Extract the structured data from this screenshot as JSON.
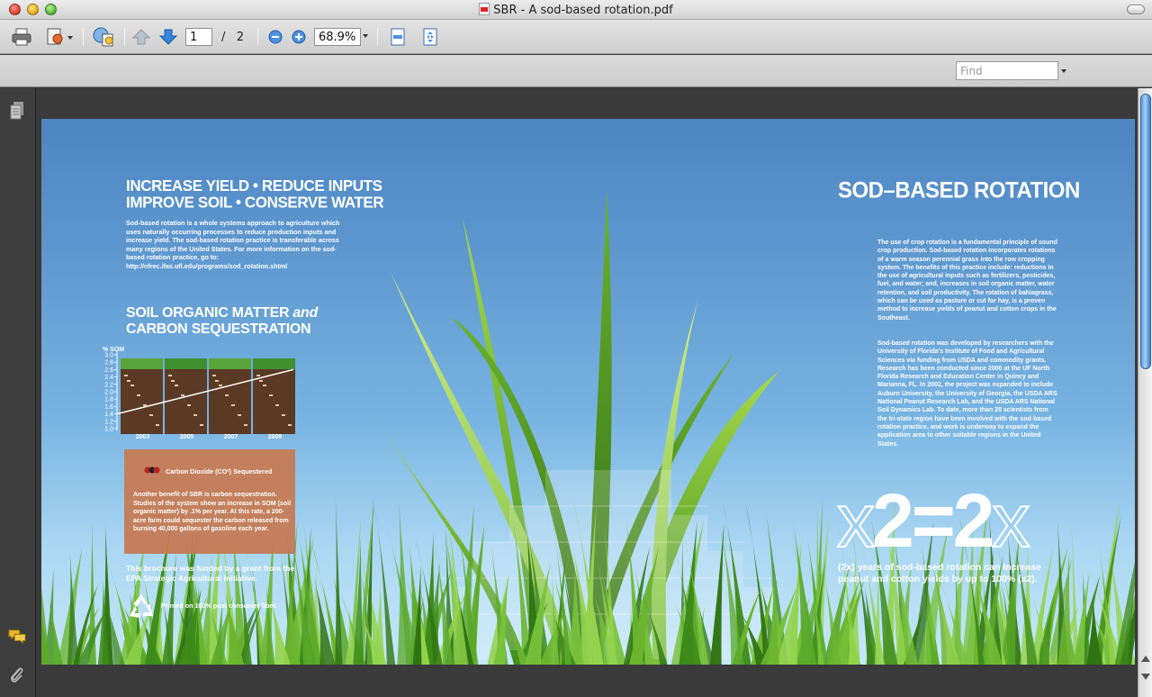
{
  "window": {
    "title": "SBR - A sod-based rotation.pdf"
  },
  "toolbar": {
    "page_current": "1",
    "page_separator": "/",
    "page_total": "2",
    "zoom": "68.9%"
  },
  "find": {
    "placeholder": "Find"
  },
  "document": {
    "headline_line1": "INCREASE YIELD  •  REDUCE INPUTS",
    "headline_line2": "IMPROVE SOIL  •  CONSERVE WATER",
    "intro": "Sod-based rotation is a whole systems approach to agriculture which uses naturally occurring processes to reduce production inputs and increase yield. The sod-based rotation practice is transferable across many regions of the United States. For more information on the sod-based rotation practice, go to: http://nfrec.ifas.ufl.edu/programs/sod_rotation.shtml",
    "som_heading_part1": "SOIL ORGANIC MATTER ",
    "som_heading_and": "and",
    "som_heading_line2": "CARBON SEQUESTRATION",
    "co2_label": "Carbon Dioxide (CO²) Sequestered",
    "tan_text": "Another benefit of SBR is carbon sequestration. Studies of the system show an increase in SOM (soil organic matter) by .1% per year. At this rate, a 200-acre farm could sequester the carbon released from burning 40,000 gallons of gasoline each year.",
    "funded": "This brochure was funded by a grant from the EPA Strategic Agricultural Initiative.",
    "printed": "Printed on 100% post consumer fiber.",
    "sbr_title": "SOD–BASED ROTATION",
    "right_p1": "The use of crop rotation is a fundamental principle of sound crop production. Sod-based rotation incorporates rotations of a warm season perennial grass into the row cropping system. The benefits of this practice include: reductions in the use of agricultural inputs such as fertilizers, pesticides, fuel, and water; and, increases in soil organic matter, water retention, and soil productivity. The rotation of bahiagrass, which can be used as pasture or cut for hay, is a proven method to increase yields of peanut and cotton crops in the Southeast.",
    "right_p2": "Sod-based rotation was developed by researchers with the University of Florida's Institute of Food and Agricultural Sciences via funding from USDA and commodity grants. Research has been conducted since 2000 at the UF North Florida Research and Education Center in Quincy and Marianna, FL. In 2002, the project was expanded to include Auburn University, the University of Georgia, the USDA ARS National Peanut Research Lab, and the USDA ARS National Soil Dynamics Lab. To date, more than 20 scientists from the tri-state region have been involved with the sod-based rotation practice, and work is underway to expand the application area to other suitable regions in the United States.",
    "eq_x1": "x",
    "eq_mid": "2=2",
    "eq_x2": "x",
    "eq_caption": "(2x) years of sod-based rotation can increase peanut and cotton yields by up to 100% (x2)."
  },
  "chart_data": {
    "type": "line",
    "title": "",
    "ylabel": "% SOM",
    "y_ticks": [
      "3.0",
      "2.8",
      "2.6",
      "2.4",
      "2.2",
      "2.0",
      "1.8",
      "1.6",
      "1.4",
      "1.2",
      "1.0"
    ],
    "x_labels": [
      "2003",
      "2005",
      "2007",
      "2009"
    ],
    "ylim": [
      1.0,
      3.0
    ],
    "series": [
      {
        "x": [
          2002,
          2009.6
        ],
        "y": [
          1.4,
          2.6
        ]
      }
    ]
  }
}
